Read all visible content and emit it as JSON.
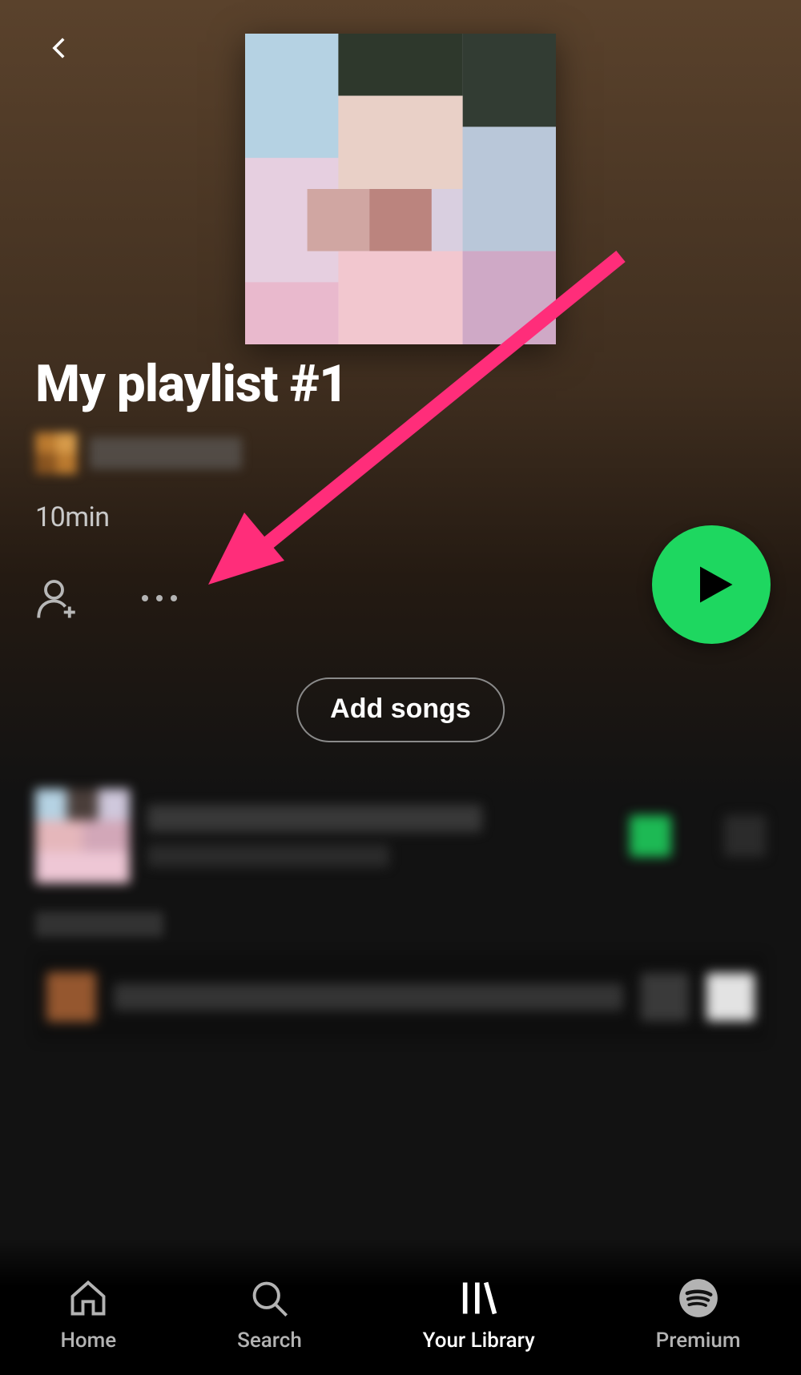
{
  "playlist": {
    "title": "My playlist #1",
    "duration_label": "10min"
  },
  "buttons": {
    "add_songs": "Add songs"
  },
  "nav": {
    "home": "Home",
    "search": "Search",
    "library": "Your Library",
    "premium": "Premium"
  },
  "colors": {
    "accent_green": "#1ed760",
    "annotation_pink": "#ff2d7a"
  }
}
